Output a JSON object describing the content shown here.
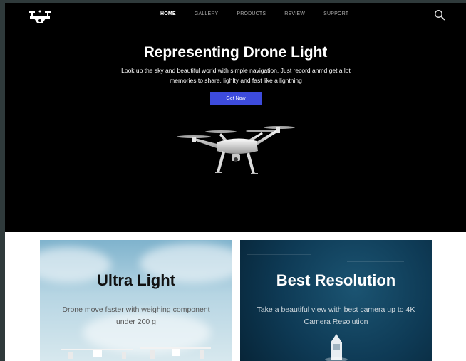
{
  "nav": {
    "items": [
      {
        "label": "HOME",
        "active": true
      },
      {
        "label": "GALLERY",
        "active": false
      },
      {
        "label": "PRODUCTS",
        "active": false
      },
      {
        "label": "REVIEW",
        "active": false
      },
      {
        "label": "SUPPORT",
        "active": false
      }
    ]
  },
  "hero": {
    "title": "Representing Drone Light",
    "text": "Look up the sky and beautiful world with simple navigation. Just record anmd get a lot memories to share, lighlty and fast like a lightning",
    "cta_label": "Get Now"
  },
  "cards": [
    {
      "title": "Ultra Light",
      "text": "Drone move faster with weighing component under 200 g"
    },
    {
      "title": "Best Resolution",
      "text": "Take a beautiful view with best camera up to 4K Camera Resolution"
    }
  ],
  "colors": {
    "accent": "#3d4bdc",
    "hero_bg": "#000000",
    "page_bg": "#ffffff"
  },
  "icons": {
    "logo": "drone-logo-icon",
    "search": "search-icon"
  }
}
